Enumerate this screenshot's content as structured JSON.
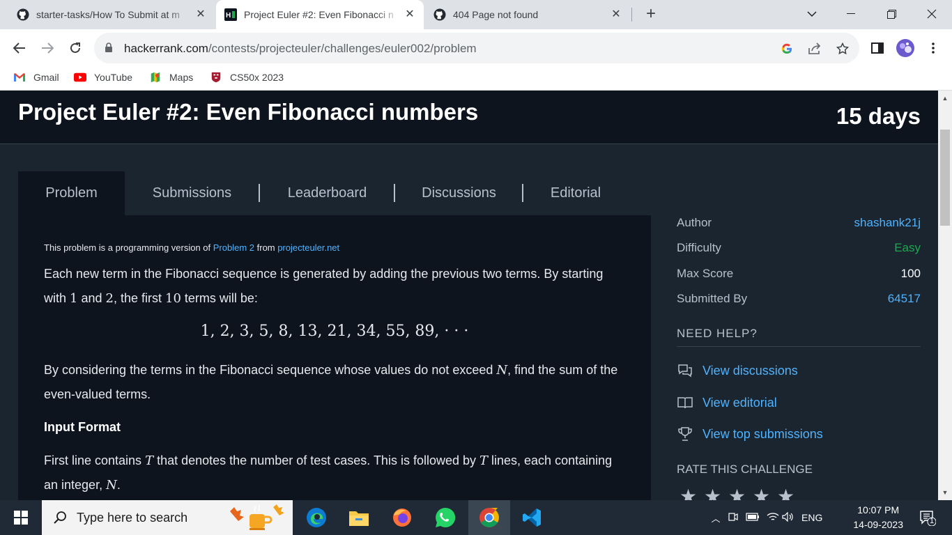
{
  "browser": {
    "tabs": [
      {
        "title": "starter-tasks/How To Submit at m",
        "active": false,
        "icon": "github-icon"
      },
      {
        "title": "Project Euler #2: Even Fibonacci n",
        "active": true,
        "icon": "hackerrank-icon"
      },
      {
        "title": "404 Page not found",
        "active": false,
        "icon": "github-icon"
      }
    ],
    "url_host": "hackerrank.com",
    "url_path": "/contests/projecteuler/challenges/euler002/problem",
    "bookmarks": [
      {
        "label": "Gmail",
        "icon": "gmail-icon"
      },
      {
        "label": "YouTube",
        "icon": "youtube-icon"
      },
      {
        "label": "Maps",
        "icon": "maps-icon"
      },
      {
        "label": "CS50x 2023",
        "icon": "harvard-icon"
      }
    ]
  },
  "header": {
    "title": "Project Euler #2: Even Fibonacci numbers",
    "days": "15 days"
  },
  "tabs": [
    {
      "label": "Problem",
      "active": true
    },
    {
      "label": "Submissions",
      "active": false
    },
    {
      "label": "Leaderboard",
      "active": false
    },
    {
      "label": "Discussions",
      "active": false
    },
    {
      "label": "Editorial",
      "active": false
    }
  ],
  "problem": {
    "source_prefix": "This problem is a programming version of ",
    "source_link1": "Problem 2",
    "source_mid": " from ",
    "source_link2": "projecteuler.net",
    "p1_a": "Each new term in the Fibonacci sequence is generated by adding the previous two terms. By starting with ",
    "p1_n1": "1",
    "p1_b": " and ",
    "p1_n2": "2",
    "p1_c": ", the first ",
    "p1_n3": "10",
    "p1_d": " terms will be:",
    "sequence": "1, 2, 3, 5, 8, 13, 21, 34, 55, 89, · · ·",
    "p2_a": "By considering the terms in the Fibonacci sequence whose values do not exceed ",
    "p2_var": "N",
    "p2_b": ", find the sum of the even-valued terms.",
    "input_format_heading": "Input Format",
    "p3_a": "First line contains ",
    "p3_var1": "T",
    "p3_b": " that denotes the number of test cases. This is followed by ",
    "p3_var2": "T",
    "p3_c": " lines, each containing an integer, ",
    "p3_var3": "N",
    "p3_d": "."
  },
  "sidebar": {
    "author_label": "Author",
    "author_value": "shashank21j",
    "difficulty_label": "Difficulty",
    "difficulty_value": "Easy",
    "max_score_label": "Max Score",
    "max_score_value": "100",
    "submitted_by_label": "Submitted By",
    "submitted_by_value": "64517",
    "need_help": "NEED HELP?",
    "help_links": [
      {
        "label": "View discussions",
        "icon": "discussions-icon"
      },
      {
        "label": "View editorial",
        "icon": "book-icon"
      },
      {
        "label": "View top submissions",
        "icon": "trophy-icon"
      }
    ],
    "rate_heading": "RATE THIS CHALLENGE",
    "rating_stars": 5
  },
  "taskbar": {
    "search_placeholder": "Type here to search",
    "lang": "ENG",
    "time": "10:07 PM",
    "date": "14-09-2023",
    "notification_count": "1"
  },
  "colors": {
    "link": "#4fb3ff",
    "easy": "#1ba94c",
    "header_bg": "#0e141e",
    "page_bg": "#1a2530"
  }
}
